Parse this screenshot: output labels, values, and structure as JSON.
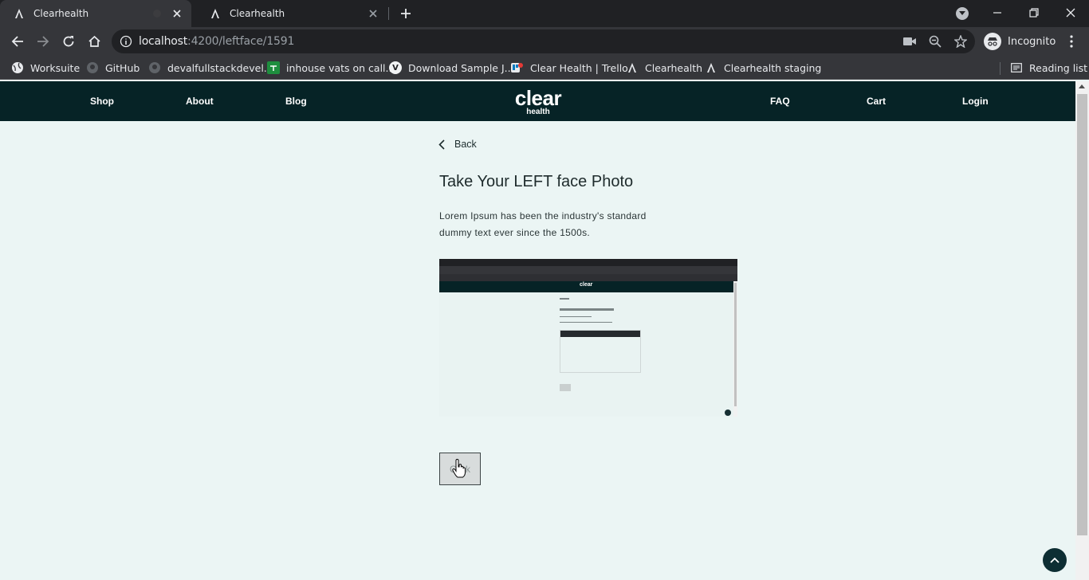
{
  "browser": {
    "tabs": [
      {
        "title": "Clearhealth",
        "active": true
      },
      {
        "title": "Clearhealth",
        "active": false
      }
    ],
    "url_host": "localhost",
    "url_path": ":4200/leftface/1591",
    "profile_label": "Incognito",
    "bookmarks": [
      {
        "label": "Worksuite",
        "icon": "globe-icon"
      },
      {
        "label": "GitHub",
        "icon": "github-icon"
      },
      {
        "label": "devalfullstackdevel...",
        "icon": "github-icon"
      },
      {
        "label": "inhouse vats on call...",
        "icon": "sheets-icon"
      },
      {
        "label": "Download Sample J...",
        "icon": "v-icon"
      },
      {
        "label": "Clear Health | Trello",
        "icon": "trello-icon"
      },
      {
        "label": "Clearhealth",
        "icon": "angular-icon"
      },
      {
        "label": "Clearhealth staging",
        "icon": "angular-icon"
      }
    ],
    "reading_list_label": "Reading list"
  },
  "site": {
    "nav_left": [
      "Shop",
      "About",
      "Blog"
    ],
    "logo_main": "clear",
    "logo_sub": "health",
    "nav_right": [
      "FAQ",
      "Cart",
      "Login"
    ]
  },
  "main": {
    "back_label": "Back",
    "title": "Take Your LEFT face Photo",
    "description": "Lorem Ipsum has been the industry's standard dummy text ever since the 1500s.",
    "preview_logo": "clear",
    "button_label": "Click"
  },
  "colors": {
    "nav_bg": "#062326",
    "page_bg": "#ebf5f4",
    "browser_dark": "#202124",
    "browser_toolbar": "#35363a"
  }
}
